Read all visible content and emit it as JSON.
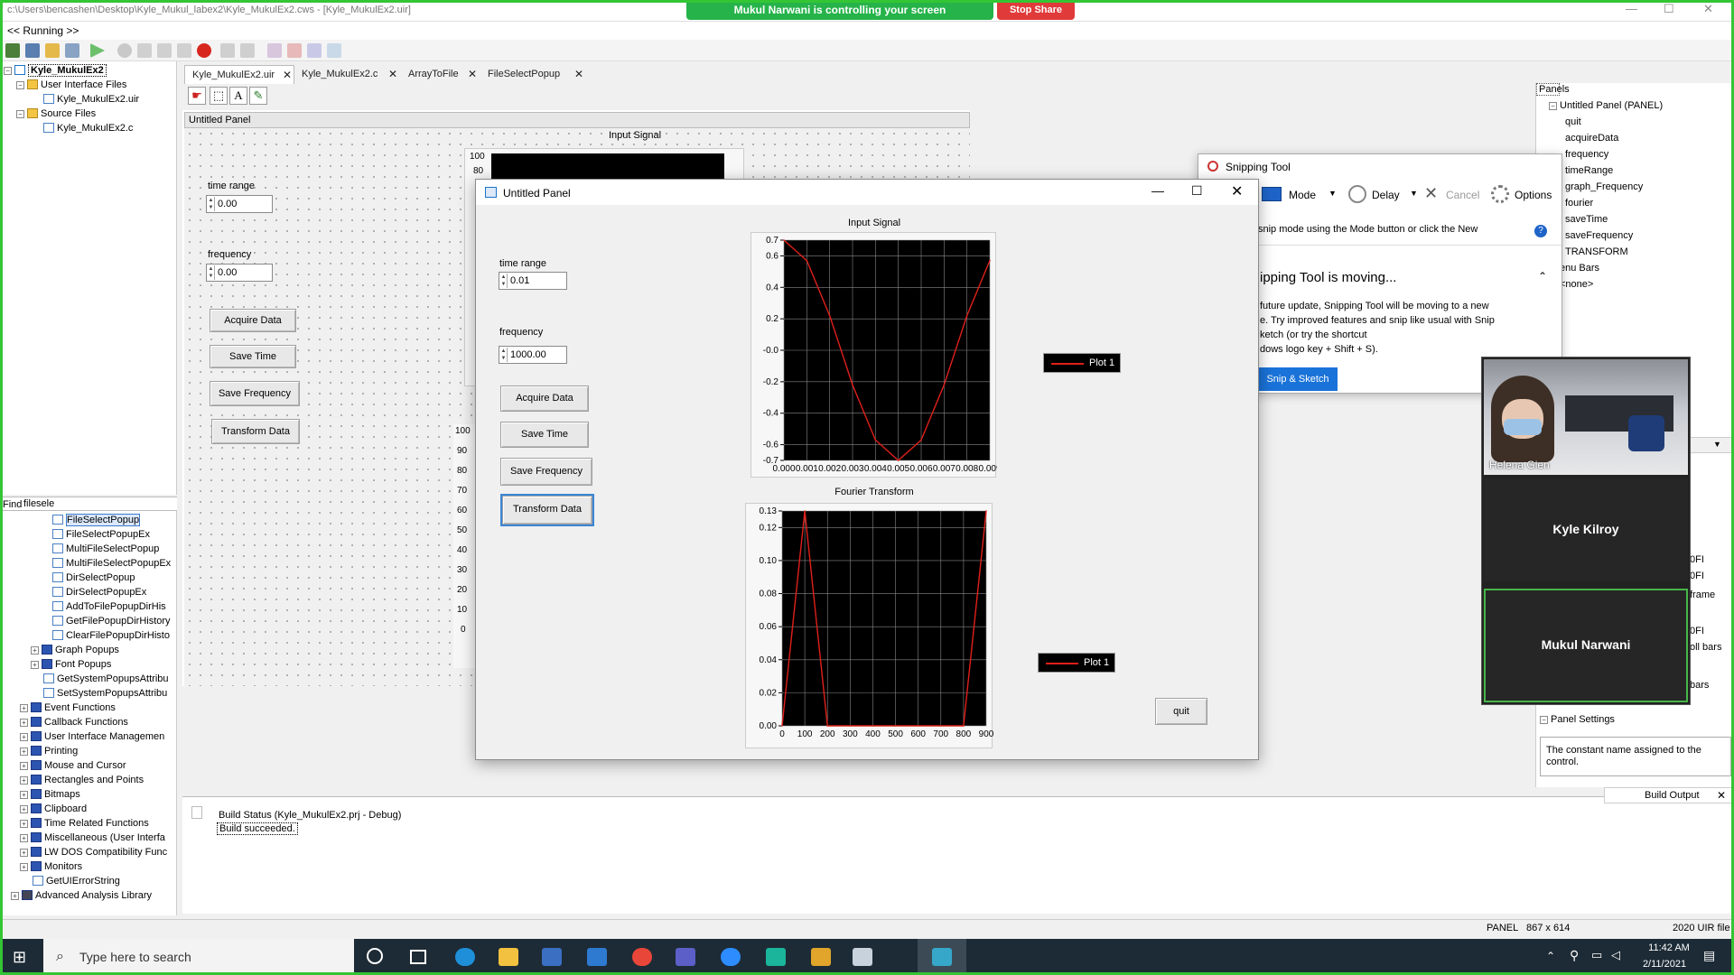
{
  "window": {
    "title": "c:\\Users\\bencashen\\Desktop\\Kyle_Mukul_labex2\\Kyle_MukulEx2.cws - [Kyle_MukulEx2.uir]",
    "menu_running": "<< Running >>"
  },
  "share": {
    "controlling": "Mukul Narwani is controlling your screen",
    "stop": "Stop Share"
  },
  "project_tree": {
    "root": "Kyle_MukulEx2",
    "ui_folder": "User Interface Files",
    "ui_file": "Kyle_MukulEx2.uir",
    "src_folder": "Source Files",
    "src_file": "Kyle_MukulEx2.c"
  },
  "find": {
    "label": "Find",
    "value": "filesele"
  },
  "function_tree": {
    "items": [
      "FileSelectPopup",
      "FileSelectPopupEx",
      "MultiFileSelectPopup",
      "MultiFileSelectPopupEx",
      "DirSelectPopup",
      "DirSelectPopupEx",
      "AddToFilePopupDirHis",
      "GetFilePopupDirHistory",
      "ClearFilePopupDirHisto"
    ],
    "groups1": [
      "Graph Popups",
      "Font Popups"
    ],
    "subitems": [
      "GetSystemPopupsAttribu",
      "SetSystemPopupsAttribu"
    ],
    "groups2": [
      "Event Functions",
      "Callback Functions",
      "User Interface Managemen",
      "Printing",
      "Mouse and Cursor",
      "Rectangles and Points",
      "Bitmaps",
      "Clipboard",
      "Time Related Functions",
      "Miscellaneous (User Interfa",
      "LW DOS Compatibility Func",
      "Monitors"
    ],
    "getuierror": "GetUIErrorString",
    "advanced": "Advanced Analysis Library"
  },
  "tabs": [
    "Kyle_MukulEx2.uir",
    "Kyle_MukulEx2.c",
    "ArrayToFile",
    "FileSelectPopup"
  ],
  "editor": {
    "panel_title": "Untitled Panel",
    "input_signal": "Input Signal",
    "time_range_label": "time range",
    "time_range_value": "0.00",
    "frequency_label": "frequency",
    "frequency_value": "0.00",
    "buttons": [
      "Acquire Data",
      "Save Time",
      "Save Frequency",
      "Transform Data"
    ],
    "partial_axis": [
      "100",
      "90",
      "80",
      "70",
      "60",
      "50",
      "40",
      "30",
      "20",
      "10",
      "0"
    ]
  },
  "running_panel": {
    "title": "Untitled Panel",
    "time_range_label": "time range",
    "time_range_value": "0.01",
    "frequency_label": "frequency",
    "frequency_value": "1000.00",
    "buttons": [
      "Acquire Data",
      "Save Time",
      "Save Frequency",
      "Transform Data"
    ],
    "quit": "quit",
    "legend1": "Plot 1",
    "legend2": "Plot 1"
  },
  "chart_data": [
    {
      "type": "line",
      "title": "Input Signal",
      "x": [
        0.0,
        0.001,
        0.002,
        0.003,
        0.004,
        0.005,
        0.006,
        0.007,
        0.008,
        0.009
      ],
      "series": [
        {
          "name": "Plot 1",
          "values": [
            0.7,
            0.57,
            0.22,
            -0.22,
            -0.57,
            -0.7,
            -0.57,
            -0.22,
            0.22,
            0.57
          ]
        }
      ],
      "xticks": [
        "0.000",
        "0.001",
        "0.002",
        "0.003",
        "0.004",
        "0.005",
        "0.006",
        "0.007",
        "0.008",
        "0.009"
      ],
      "yticks": [
        "0.7",
        "0.6",
        "0.4",
        "0.2",
        "-0.0",
        "-0.2",
        "-0.4",
        "-0.6",
        "-0.7"
      ],
      "ylim": [
        -0.7,
        0.7
      ],
      "color": "#e0201a"
    },
    {
      "type": "line",
      "title": "Fourier Transform",
      "x": [
        0,
        100,
        200,
        300,
        400,
        500,
        600,
        700,
        800,
        900
      ],
      "series": [
        {
          "name": "Plot 1",
          "values": [
            0.0,
            0.13,
            0.0,
            0.0,
            0.0,
            0.0,
            0.0,
            0.0,
            0.0,
            0.13
          ]
        }
      ],
      "xticks": [
        "0",
        "100",
        "200",
        "300",
        "400",
        "500",
        "600",
        "700",
        "800",
        "900"
      ],
      "yticks": [
        "0.13",
        "0.12",
        "0.10",
        "0.08",
        "0.06",
        "0.04",
        "0.02",
        "0.00"
      ],
      "ylim": [
        0,
        0.13
      ],
      "color": "#e0201a"
    }
  ],
  "snipping_tool": {
    "title": "Snipping Tool",
    "mode": "Mode",
    "delay": "Delay",
    "cancel": "Cancel",
    "options": "Options",
    "hint": "snip mode using the Mode button or click the New",
    "moving_title": "ipping Tool is moving...",
    "moving_body_1": "future update, Snipping Tool will be moving to a new",
    "moving_body_2": "e. Try improved features and snip like usual with Snip",
    "moving_body_3": "ketch (or try the shortcut",
    "moving_body_4": "dows logo key + Shift + S).",
    "button": "Snip & Sketch"
  },
  "panels_tree": {
    "header": "Panels",
    "panel": "Untitled Panel (PANEL)",
    "controls": [
      "quit",
      "acquireData",
      "frequency",
      "timeRange",
      "graph_Frequency",
      "fourier",
      "saveTime",
      "saveFrequency",
      "TRANSFORM"
    ],
    "menu_bars": "enu Bars",
    "none": "<none>",
    "partial": [
      "0FI",
      "0FI",
      "frame",
      "0FI",
      "oll bars",
      "bars"
    ],
    "panel_settings": "Panel Settings",
    "description": "The constant name assigned to the control."
  },
  "video": {
    "person1": "Helena Gien",
    "person2": "Kyle Kilroy",
    "person3": "Mukul Narwani"
  },
  "output": {
    "status": "Build Status (Kyle_MukulEx2.prj - Debug)",
    "succeeded": "Build succeeded.",
    "tab": "Build Output"
  },
  "statusbar": {
    "panel": "PANEL",
    "size": "867 x 614",
    "file": "2020 UIR file"
  },
  "taskbar": {
    "search": "Type here to search",
    "time": "11:42 AM",
    "date": "2/11/2021"
  }
}
